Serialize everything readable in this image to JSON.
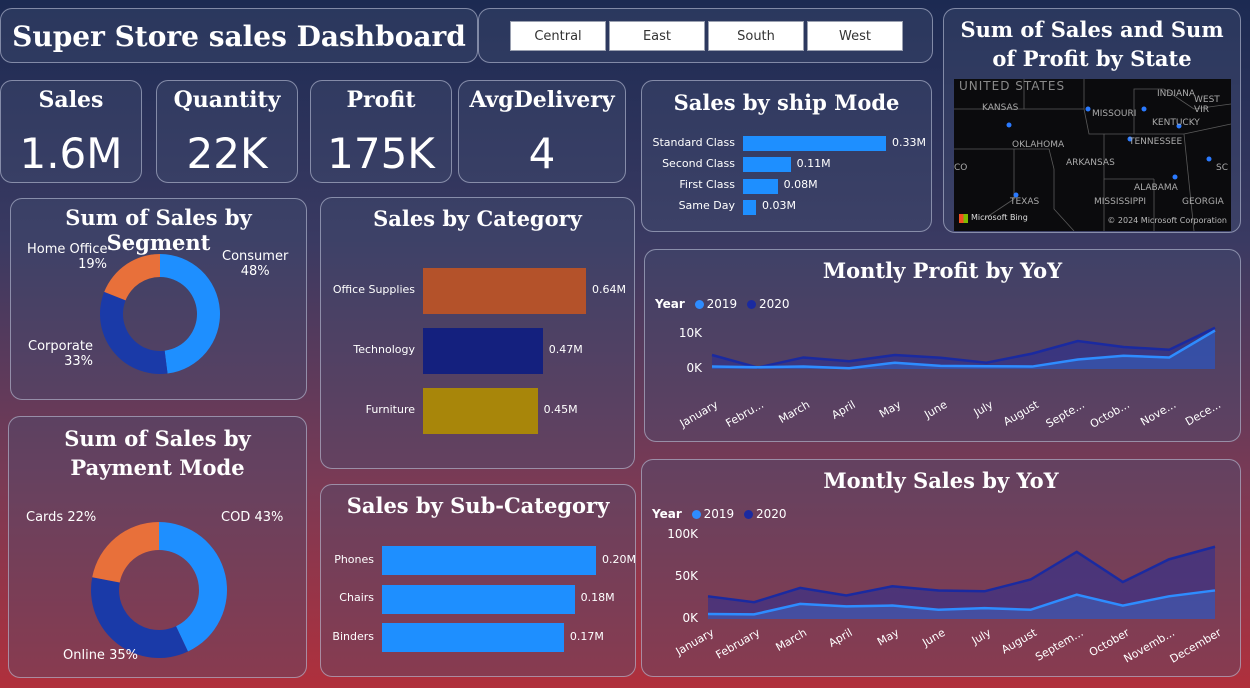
{
  "header": {
    "title": "Super Store sales Dashboard"
  },
  "slicer": {
    "regions": [
      "Central",
      "East",
      "South",
      "West"
    ]
  },
  "kpis": {
    "sales": {
      "label": "Sales",
      "value": "1.6M"
    },
    "quantity": {
      "label": "Quantity",
      "value": "22K"
    },
    "profit": {
      "label": "Profit",
      "value": "175K"
    },
    "delivery": {
      "label": "AvgDelivery",
      "value": "4"
    }
  },
  "map": {
    "title": "Sum of Sales and Sum of Profit by State",
    "labels": [
      "UNITED STATES",
      "KANSAS",
      "MISSOURI",
      "INDIANA",
      "WEST VIR",
      "KENTUCKY",
      "OKLAHOMA",
      "TENNESSEE",
      "ARKANSAS",
      "CO",
      "SC",
      "ALABAMA",
      "TEXAS",
      "MISSISSIPPI",
      "GEORGIA"
    ],
    "brand": "Microsoft Bing",
    "copyright": "© 2024 Microsoft Corporation"
  },
  "segment": {
    "title": "Sum of Sales by Segment",
    "slices": [
      {
        "name": "Consumer",
        "pct": "48%",
        "value": 48,
        "color": "#1e8fff"
      },
      {
        "name": "Corporate",
        "pct": "33%",
        "value": 33,
        "color": "#1a3aa8"
      },
      {
        "name": "Home Office",
        "pct": "19%",
        "value": 19,
        "color": "#e8703a"
      }
    ]
  },
  "payment": {
    "title": "Sum of Sales by Payment Mode",
    "slices": [
      {
        "name": "COD",
        "label": "COD 43%",
        "value": 43,
        "color": "#1e8fff"
      },
      {
        "name": "Online",
        "label": "Online 35%",
        "value": 35,
        "color": "#1a3aa8"
      },
      {
        "name": "Cards",
        "label": "Cards 22%",
        "value": 22,
        "color": "#e8703a"
      }
    ]
  },
  "category": {
    "title": "Sales by Category",
    "items": [
      {
        "name": "Office Supplies",
        "value": 0.64,
        "label": "0.64M",
        "color": "#b4522a"
      },
      {
        "name": "Technology",
        "value": 0.47,
        "label": "0.47M",
        "color": "#14207e"
      },
      {
        "name": "Furniture",
        "value": 0.45,
        "label": "0.45M",
        "color": "#a8860a"
      }
    ]
  },
  "subcategory": {
    "title": "Sales by Sub-Category",
    "items": [
      {
        "name": "Phones",
        "value": 0.2,
        "label": "0.20M"
      },
      {
        "name": "Chairs",
        "value": 0.18,
        "label": "0.18M"
      },
      {
        "name": "Binders",
        "value": 0.17,
        "label": "0.17M"
      }
    ]
  },
  "shipmode": {
    "title": "Sales by ship Mode",
    "items": [
      {
        "name": "Standard Class",
        "value": 0.33,
        "label": "0.33M"
      },
      {
        "name": "Second Class",
        "value": 0.11,
        "label": "0.11M"
      },
      {
        "name": "First Class",
        "value": 0.08,
        "label": "0.08M"
      },
      {
        "name": "Same Day",
        "value": 0.03,
        "label": "0.03M"
      }
    ]
  },
  "chart_data": [
    {
      "type": "area",
      "title": "Montly Profit by YoY",
      "legend_title": "Year",
      "categories": [
        "January",
        "Febru...",
        "March",
        "April",
        "May",
        "June",
        "July",
        "August",
        "Septe...",
        "Octob...",
        "Nove...",
        "Dece..."
      ],
      "yticks": [
        "10K",
        "0K"
      ],
      "ylim": [
        -2000,
        14000
      ],
      "series": [
        {
          "name": "2019",
          "color": "#2e8cff",
          "values": [
            700,
            500,
            700,
            200,
            1800,
            900,
            800,
            700,
            2700,
            3800,
            3300,
            11000
          ]
        },
        {
          "name": "2020",
          "color": "#1a2aa0",
          "values": [
            4000,
            400,
            3300,
            2200,
            4000,
            3200,
            1800,
            4400,
            8000,
            6300,
            5500,
            11800
          ]
        }
      ]
    },
    {
      "type": "area",
      "title": "Montly Sales by YoY",
      "legend_title": "Year",
      "categories": [
        "January",
        "February",
        "March",
        "April",
        "May",
        "June",
        "July",
        "August",
        "Septem...",
        "October",
        "Novemb...",
        "December"
      ],
      "yticks": [
        "100K",
        "50K",
        "0K"
      ],
      "ylim": [
        0,
        100000
      ],
      "series": [
        {
          "name": "2019",
          "color": "#2e8cff",
          "values": [
            6000,
            5500,
            18000,
            15000,
            16000,
            11000,
            13000,
            11000,
            29000,
            16000,
            27000,
            34000
          ]
        },
        {
          "name": "2020",
          "color": "#1a2aa0",
          "values": [
            27000,
            20000,
            37000,
            28000,
            39000,
            34000,
            33000,
            47000,
            80000,
            44000,
            71000,
            86000
          ]
        }
      ]
    }
  ]
}
